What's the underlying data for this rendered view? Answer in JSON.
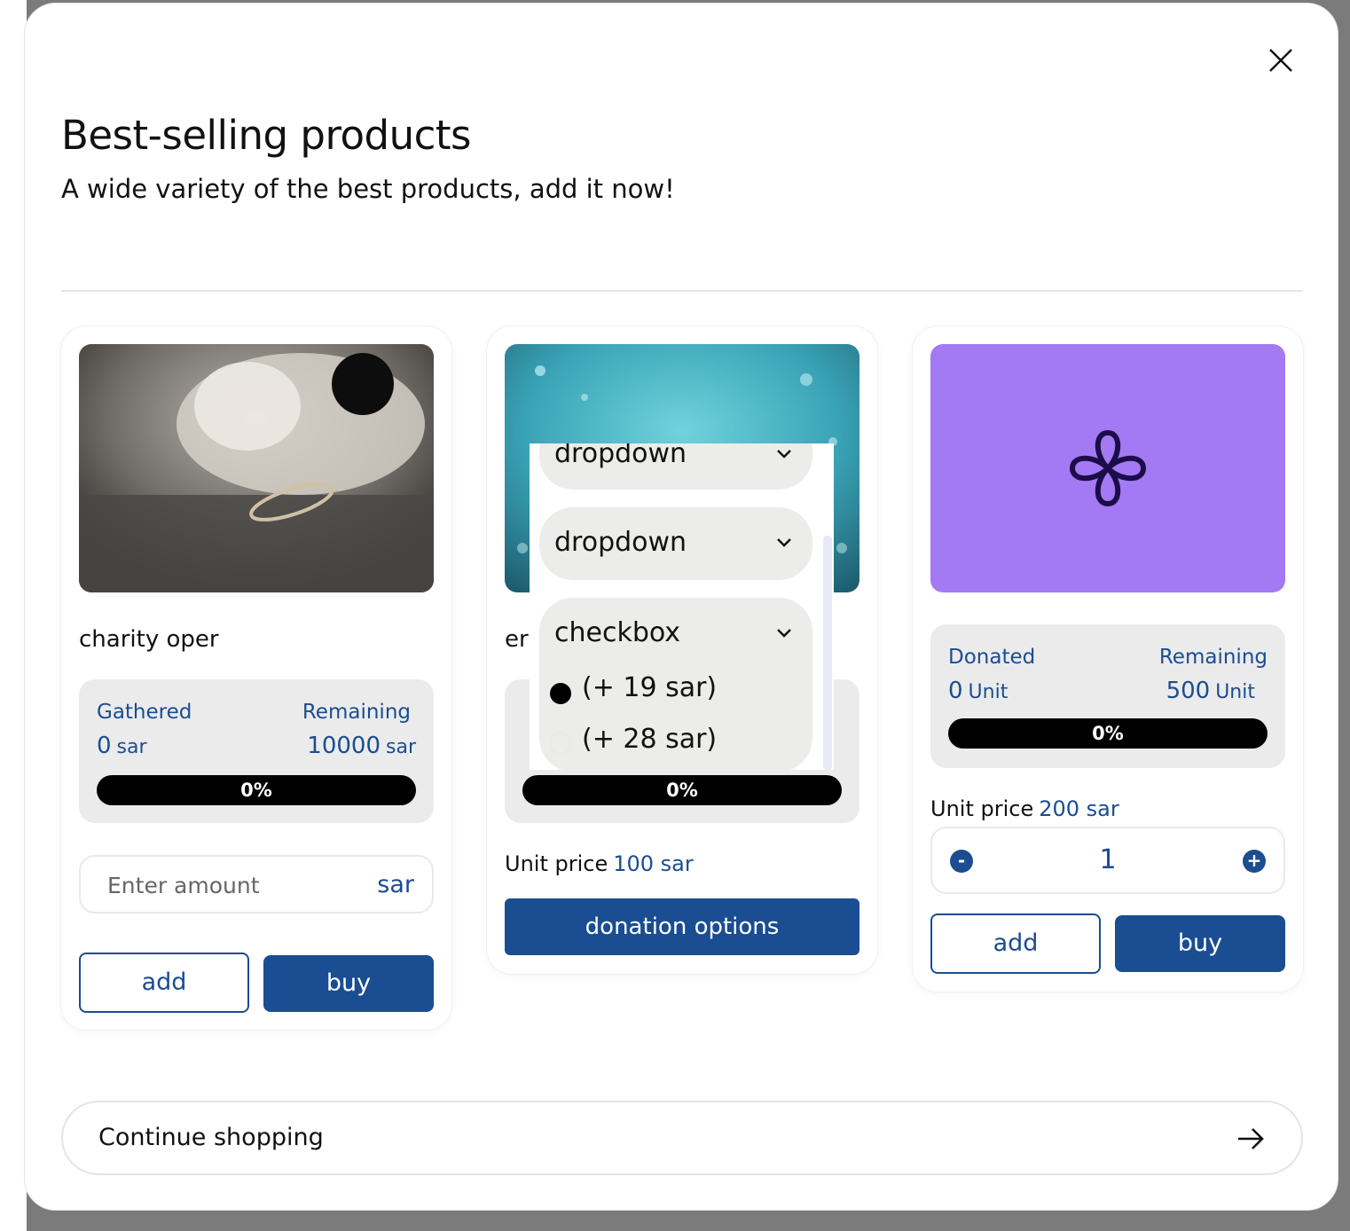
{
  "modal": {
    "title": "Best-selling products",
    "subtitle": "A wide variety of the best products, add it now!",
    "continue_label": "Continue shopping"
  },
  "products": [
    {
      "name": "charity oper",
      "stat_left_label": "Gathered",
      "stat_left_value": "0",
      "stat_left_unit": "sar",
      "stat_right_label": "Remaining",
      "stat_right_value": "10000",
      "stat_right_unit": "sar",
      "progress": "0%",
      "amount_placeholder": "Enter amount",
      "amount_currency": "sar",
      "add_label": "add",
      "buy_label": "buy"
    },
    {
      "name": "er",
      "progress": "0%",
      "unit_price_label": "Unit price",
      "unit_price_value": "100 sar",
      "donation_options_label": "donation options"
    },
    {
      "stat_left_label": "Donated",
      "stat_left_value": "0",
      "stat_left_unit": "Unit",
      "stat_right_label": "Remaining",
      "stat_right_value": "500",
      "stat_right_unit": "Unit",
      "progress": "0%",
      "unit_price_label": "Unit price",
      "unit_price_value": "200 sar",
      "quantity": "1",
      "minus_label": "-",
      "plus_label": "+",
      "add_label": "add",
      "buy_label": "buy",
      "image_color": "#a37af3"
    }
  ],
  "dropdown_overlay": {
    "items": [
      {
        "label": "dropdown"
      },
      {
        "label": "dropdown"
      },
      {
        "label": "checkbox"
      }
    ],
    "options": [
      {
        "label": "(+ 19 sar)",
        "selected": true
      },
      {
        "label": "(+ 28 sar)",
        "selected": false
      }
    ]
  },
  "colors": {
    "brand": "#1a4d91",
    "overlay": "#7b7b7b",
    "progress_bg": "#000000"
  }
}
